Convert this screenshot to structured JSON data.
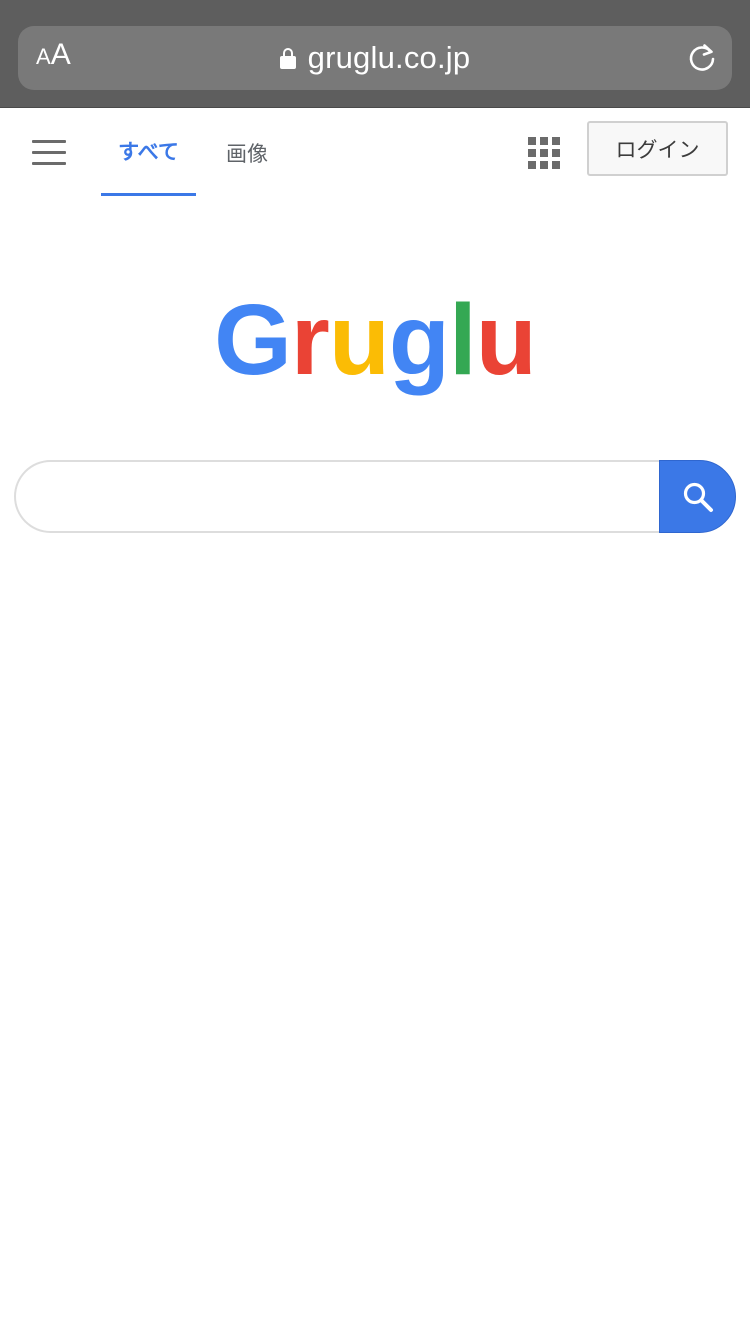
{
  "browser": {
    "text_size_small": "A",
    "text_size_large": "A",
    "url": "gruglu.co.jp"
  },
  "nav": {
    "tabs": [
      {
        "label": "すべて",
        "active": true
      },
      {
        "label": "画像",
        "active": false
      }
    ],
    "login_label": "ログイン"
  },
  "logo": {
    "letters": [
      {
        "char": "G",
        "color": "#4285f4"
      },
      {
        "char": "r",
        "color": "#ea4335"
      },
      {
        "char": "u",
        "color": "#fbbc05"
      },
      {
        "char": "g",
        "color": "#4285f4"
      },
      {
        "char": "l",
        "color": "#34a853"
      },
      {
        "char": "u",
        "color": "#ea4335"
      }
    ]
  },
  "search": {
    "value": "",
    "placeholder": ""
  },
  "colors": {
    "accent": "#3b78e7",
    "browser_chrome": "#5e5e5e"
  },
  "icons": {
    "menu": "hamburger-menu-icon",
    "apps": "apps-grid-icon",
    "search": "magnifier-icon",
    "lock": "lock-icon",
    "reload": "reload-icon"
  }
}
